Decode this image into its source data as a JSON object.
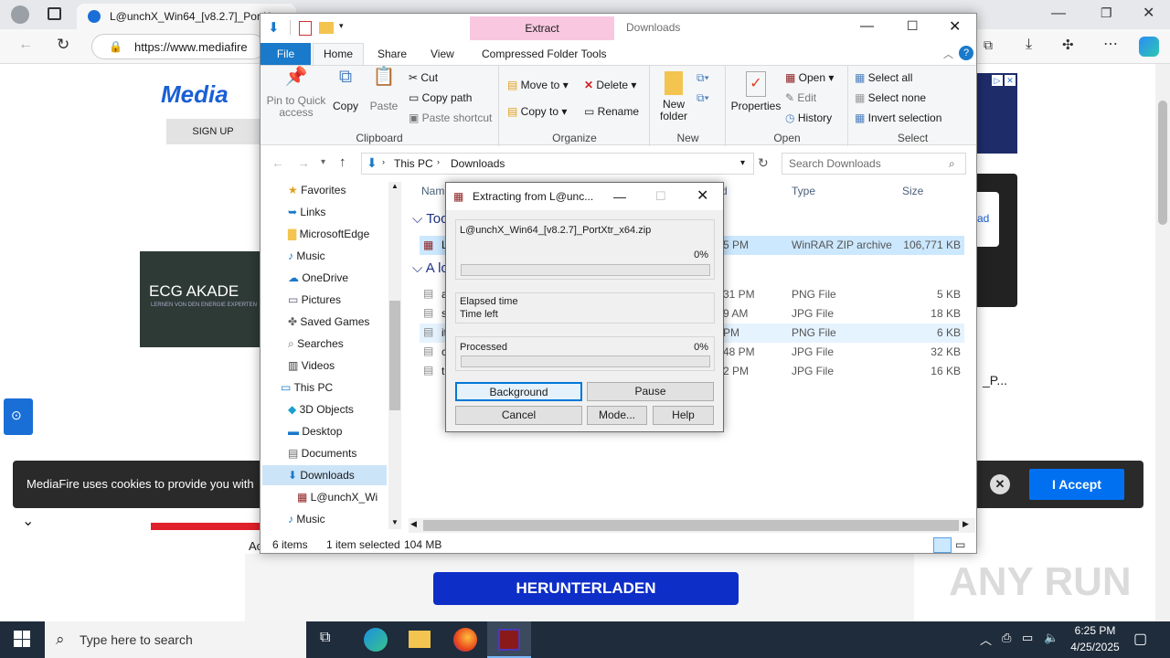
{
  "browser": {
    "tab_title": "L@unchX_Win64_[v8.2.7]_PortX",
    "url": "https://www.mediafire",
    "site_logo": "Media",
    "sign_up": "SIGN UP",
    "ad_text": "ECG AKADE",
    "ad_sub": "LERNEN VON DEN ENERGIE EXPERTEN",
    "side_text": "ad",
    "side_text2": "_P...",
    "acc_text": "Ac",
    "cookie_text": "MediaFire uses cookies to provide you with",
    "accept_label": "I Accept",
    "download_label": "HERUNTERLADEN"
  },
  "explorer": {
    "context_tab": "Extract",
    "window_title": "Downloads",
    "ribbon_tabs": [
      "File",
      "Home",
      "Share",
      "View",
      "Compressed Folder Tools"
    ],
    "clipboard": {
      "pin": "Pin to Quick access",
      "copy": "Copy",
      "paste": "Paste",
      "cut": "Cut",
      "copy_path": "Copy path",
      "paste_shortcut": "Paste shortcut",
      "label": "Clipboard"
    },
    "organize": {
      "move_to": "Move to",
      "copy_to": "Copy to",
      "delete": "Delete",
      "rename": "Rename",
      "label": "Organize"
    },
    "new_group": {
      "new_folder": "New folder",
      "label": "New"
    },
    "open_group": {
      "properties": "Properties",
      "open": "Open",
      "edit": "Edit",
      "history": "History",
      "label": "Open"
    },
    "select_group": {
      "select_all": "Select all",
      "select_none": "Select none",
      "invert": "Invert selection",
      "label": "Select"
    },
    "breadcrumb": [
      "This PC",
      "Downloads"
    ],
    "search_placeholder": "Search Downloads",
    "nav_items": [
      {
        "label": "Favorites"
      },
      {
        "label": "Links"
      },
      {
        "label": "MicrosoftEdge"
      },
      {
        "label": "Music"
      },
      {
        "label": "OneDrive"
      },
      {
        "label": "Pictures"
      },
      {
        "label": "Saved Games"
      },
      {
        "label": "Searches"
      },
      {
        "label": "Videos"
      },
      {
        "label": "This PC"
      },
      {
        "label": "3D Objects"
      },
      {
        "label": "Desktop"
      },
      {
        "label": "Documents"
      },
      {
        "label": "Downloads"
      },
      {
        "label": "L@unchX_Wi"
      },
      {
        "label": "Music"
      }
    ],
    "columns": {
      "name": "Nam",
      "date": "d",
      "type": "Type",
      "size": "Size"
    },
    "groups": [
      "Too",
      "A lo"
    ],
    "rows": [
      {
        "name": "L",
        "date": "5 PM",
        "type": "WinRAR ZIP archive",
        "size": "106,771 KB"
      },
      {
        "name": "a",
        "date": "31 PM",
        "type": "PNG File",
        "size": "5 KB"
      },
      {
        "name": "s",
        "date": "9 AM",
        "type": "JPG File",
        "size": "18 KB"
      },
      {
        "name": "it",
        "date": " PM",
        "type": "PNG File",
        "size": "6 KB"
      },
      {
        "name": "c",
        "date": "48 PM",
        "type": "JPG File",
        "size": "32 KB"
      },
      {
        "name": "t",
        "date": "2 PM",
        "type": "JPG File",
        "size": "16 KB"
      }
    ],
    "status_items": "6 items",
    "status_selected": "1 item selected",
    "status_size": "104 MB"
  },
  "extract": {
    "title": "Extracting from L@unc...",
    "filename": "L@unchX_Win64_[v8.2.7]_PortXtr_x64.zip",
    "file_percent": "0%",
    "elapsed_label": "Elapsed time",
    "time_left_label": "Time left",
    "processed_label": "Processed",
    "processed_percent": "0%",
    "file_progress": 0,
    "processed_progress": 0,
    "buttons": {
      "background": "Background",
      "pause": "Pause",
      "cancel": "Cancel",
      "mode": "Mode...",
      "help": "Help"
    }
  },
  "taskbar": {
    "search": "Type here to search",
    "time": "6:25 PM",
    "date": "4/25/2025"
  },
  "watermark": "ANY RUN"
}
